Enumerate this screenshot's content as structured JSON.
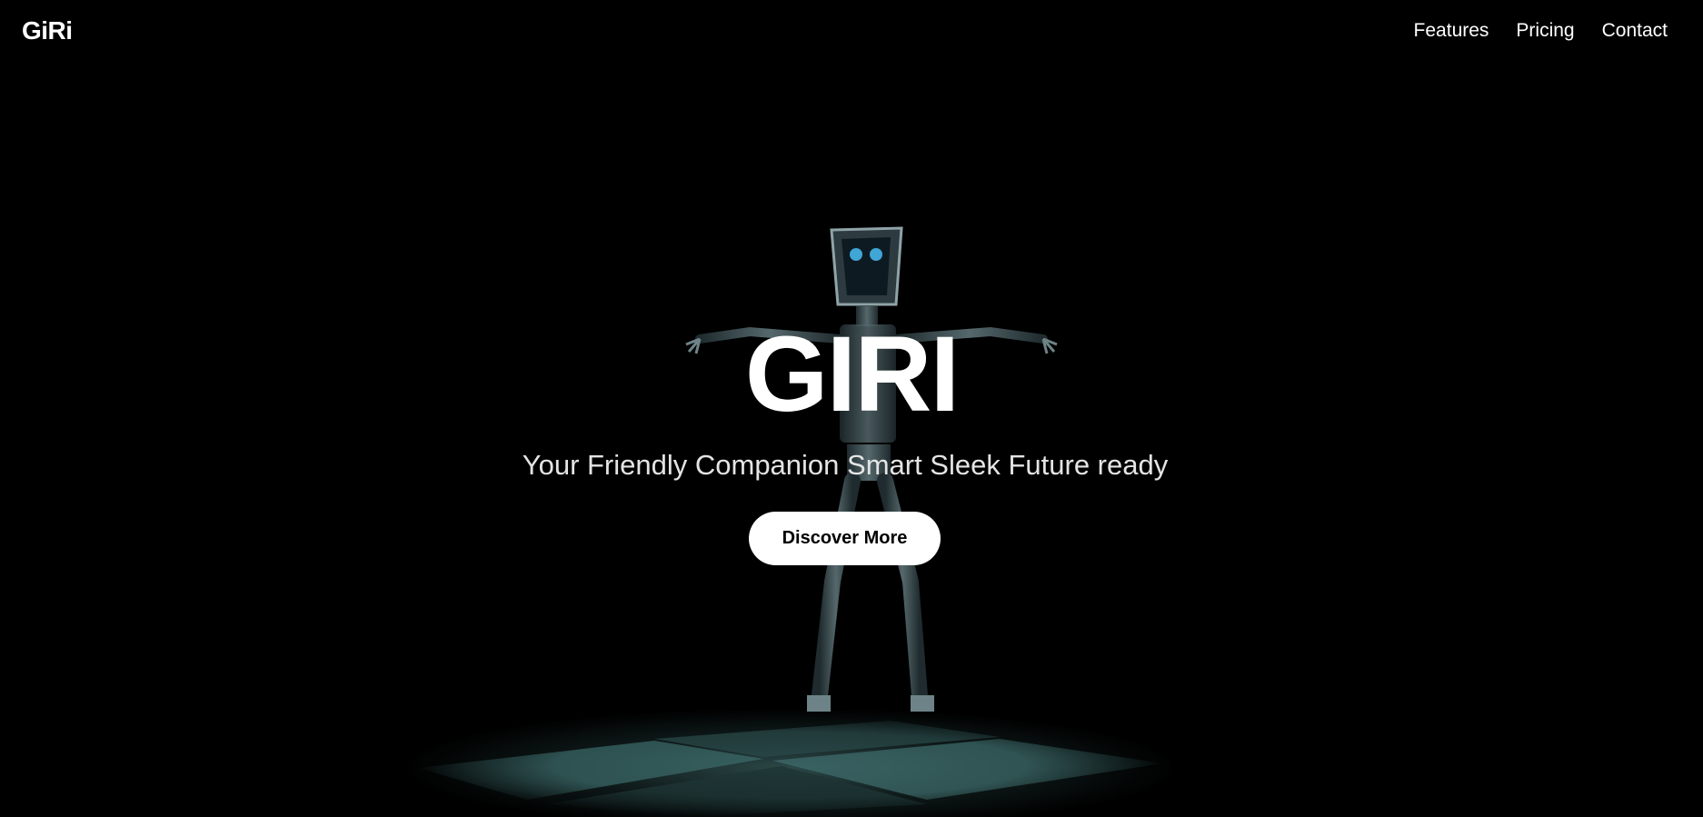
{
  "navbar": {
    "logo": "GiRi",
    "links": [
      {
        "label": "Features"
      },
      {
        "label": "Pricing"
      },
      {
        "label": "Contact"
      }
    ]
  },
  "hero": {
    "title": "GIRI",
    "subtitle": "Your Friendly Companion Smart Sleek Future ready",
    "cta_label": "Discover More"
  },
  "colors": {
    "background": "#000000",
    "text": "#ffffff",
    "button_bg": "#ffffff",
    "button_text": "#000000"
  }
}
